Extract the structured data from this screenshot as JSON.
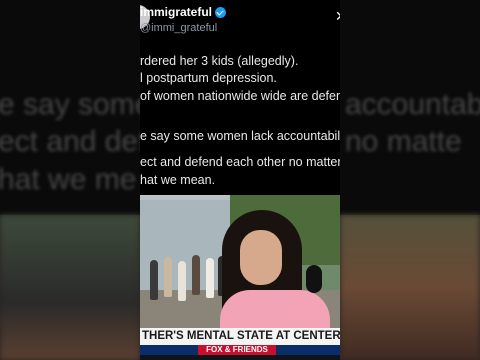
{
  "post": {
    "display_name": "immigrateful",
    "handle": "@immi_grateful",
    "lines": [
      "rdered her 3 kids (allegedly).",
      "l postpartum depression.",
      "of women nationwide wide are defen",
      "e say some women lack accountability",
      "ect and defend each other no matter",
      "hat we mean."
    ]
  },
  "background_echo": {
    "lines": [
      "e say some",
      "accountabili",
      "ect and defe",
      "no matte",
      "hat we me"
    ]
  },
  "video": {
    "chyron": "THER'S MENTAL STATE AT CENTER OF MURDER TRIAL",
    "show_logo": "FOX & FRIENDS"
  },
  "colors": {
    "verified": "#1d9bf0",
    "jacket": "#f2a3b5",
    "chyron_bg": "#f4f4f4",
    "show_bar": "#0b2e6b"
  },
  "icons": {
    "verified": "verified-badge-icon",
    "close": "close-icon"
  }
}
